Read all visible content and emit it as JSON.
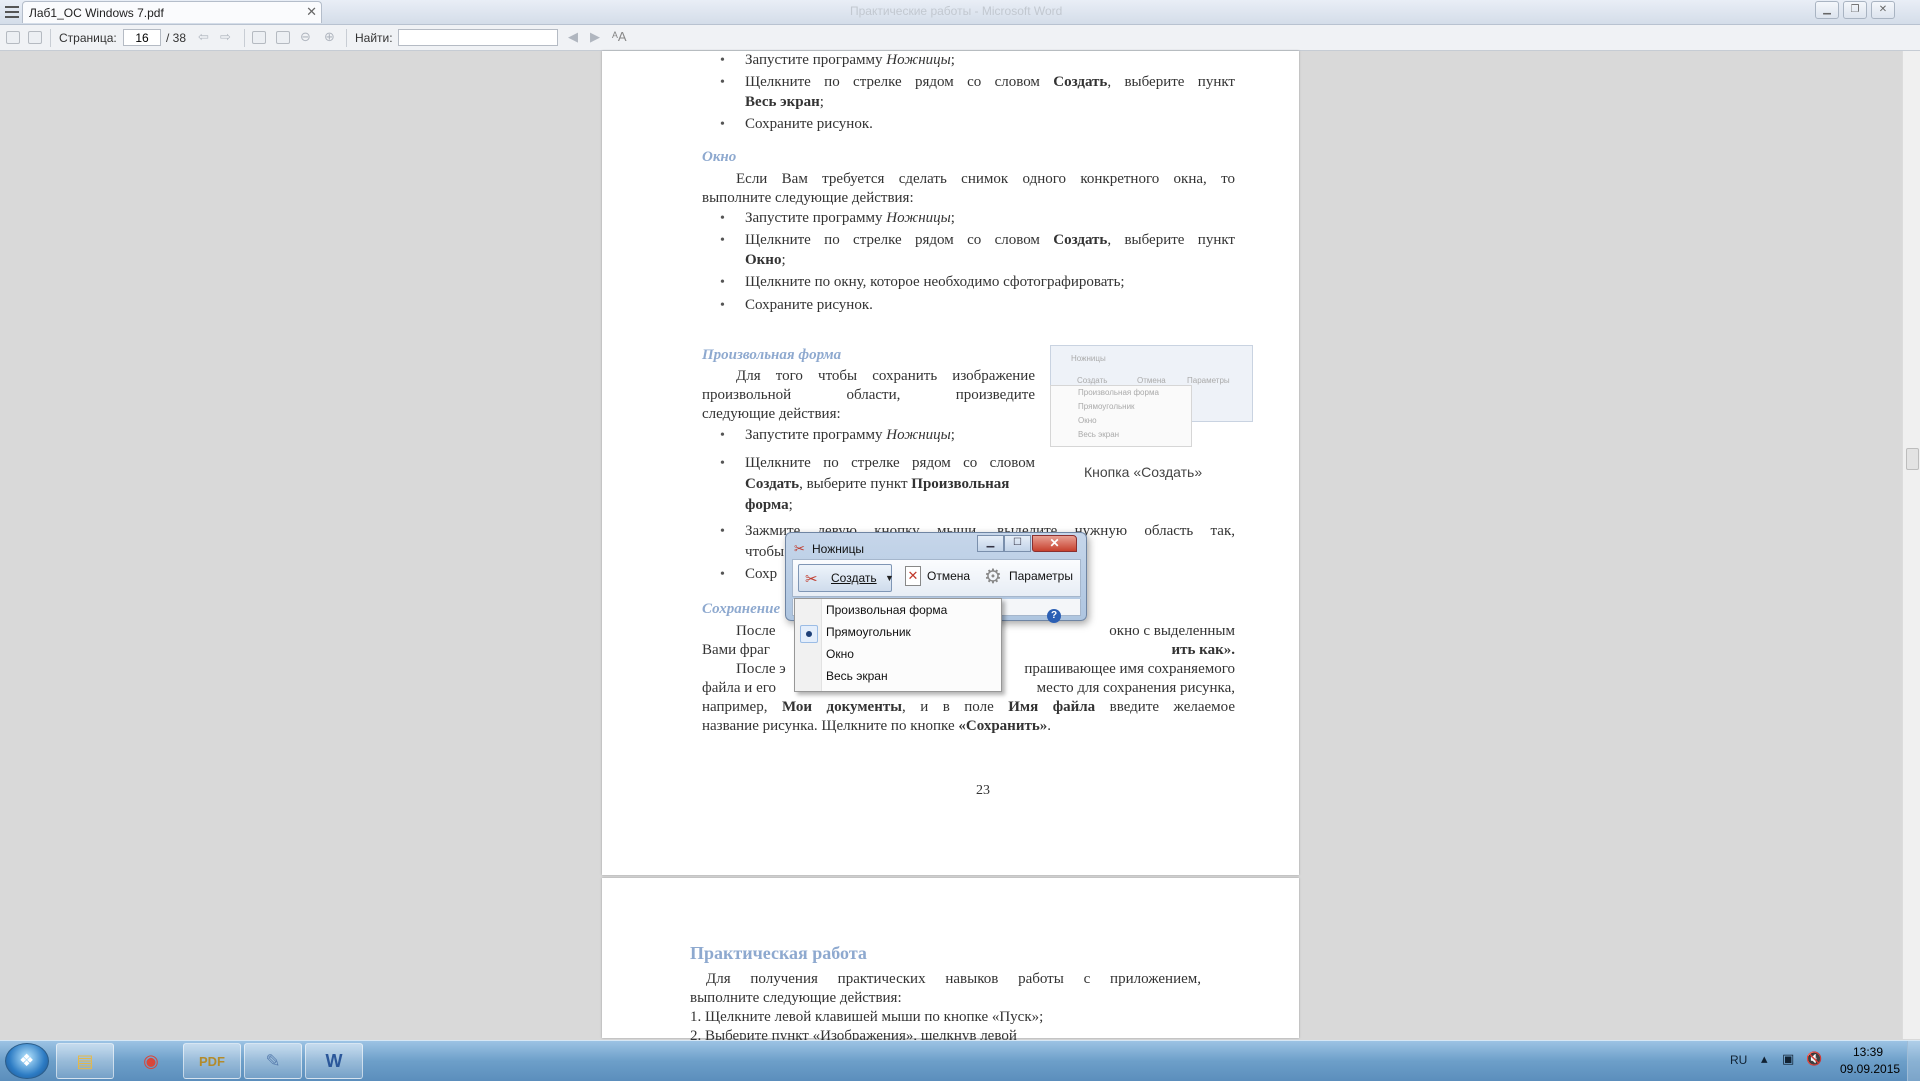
{
  "window": {
    "tab_title": "Лаб1_ОС Windows 7.pdf",
    "title": "Практические работы - Microsoft Word",
    "tab_close_icon": "close-icon"
  },
  "toolbar": {
    "page_label": "Страница:",
    "page_value": "16",
    "page_total": "/ 38",
    "find_label": "Найти:",
    "find_value": ""
  },
  "page1": {
    "bullets_top": [
      {
        "pre": "Запустите программу ",
        "it": "Ножницы",
        "post": ";"
      },
      {
        "line1": "Щелкните по стрелке рядом со словом ",
        "bold1": "Создать",
        "line1b": ", выберите пункт",
        "bold2": "Весь экран",
        "end": ";"
      },
      {
        "text": "Сохраните рисунок."
      }
    ],
    "okno_heading": "Окно",
    "okno_para_1": "Если Вам требуется сделать снимок одного конкретного окна, то",
    "okno_para_2": "выполните следующие действия:",
    "okno_b1_pre": "Запустите программу ",
    "okno_b1_it": "Ножницы",
    "okno_b1_post": ";",
    "okno_b2_pre": "Щелкните по стрелке рядом со словом ",
    "okno_b2_bold": "Создать",
    "okno_b2_post": ", выберите пункт",
    "okno_b2_bold2": "Окно",
    "okno_b2_end": ";",
    "okno_b3": "Щелкните по окну, которое необходимо сфотографировать;",
    "okno_b4": "Сохраните рисунок.",
    "free_heading": "Произвольная форма",
    "free_para_1": "Для того чтобы сохранить изображение",
    "free_para_2": "произвольной области, произведите",
    "free_para_3": "следующие действия:",
    "free_b1_pre": "Запустите программу ",
    "free_b1_it": "Ножницы",
    "free_b1_post": ";",
    "free_b2_line1": "Щелкните по стрелке рядом со словом",
    "free_b2_bold": "Создать",
    "free_b2_mid": ", выберите пункт ",
    "free_b2_bold2": "Произвольная",
    "free_b2_bold3": "форма",
    "free_b2_end": ";",
    "free_b3_visible": "Зажмите левую кнопку мыши, выделите нужную область так,",
    "free_b3_visible_2": "чтобы",
    "free_b4_visible": "Сохр",
    "save_heading": "Сохранение",
    "save_para_1a": "После",
    "save_para_1b": "окно с выделенным",
    "save_para_2a": "Вами фраг",
    "save_para_2b": "ить как».",
    "save_para_3a": "После э",
    "save_para_3b": "прашивающее имя сохраняемого",
    "save_para_4a": "файла и его",
    "save_para_4b": "место для сохранения рисунка,",
    "save_para_5_pre": "например, ",
    "save_para_5_b1": "Мои документы",
    "save_para_5_mid": ", и в поле ",
    "save_para_5_b2": "Имя файла",
    "save_para_5_post": " введите желаемое",
    "save_para_6_pre": "название рисунка. Щелкните по кнопке ",
    "save_para_6_b": "«Сохранить»",
    "save_para_6_post": ".",
    "page_number": "23",
    "figure": {
      "title": "Ножницы",
      "new": "Создать",
      "cancel": "Отмена",
      "options": "Параметры",
      "menu": [
        "Произвольная форма",
        "Прямоугольник",
        "Окно",
        "Весь экран"
      ],
      "caption": "Кнопка «Создать»"
    }
  },
  "page2": {
    "heading": "Практическая работа",
    "para_1": "Для получения практических навыков работы с приложением,",
    "para_2": "выполните следующие действия:",
    "item_1": "1.  Щелкните левой клавишей мыши по кнопке «Пуск»;",
    "item_2": "2.  Выберите пункт «Изображения», щелкнув левой"
  },
  "snipping_tool": {
    "title": "Ножницы",
    "new_label": "Создать",
    "cancel_label": "Отмена",
    "options_label": "Параметры",
    "help": "?",
    "menu": [
      {
        "label": "Произвольная форма",
        "selected": false
      },
      {
        "label": "Прямоугольник",
        "selected": true
      },
      {
        "label": "Окно",
        "selected": false
      },
      {
        "label": "Весь экран",
        "selected": false
      }
    ]
  },
  "taskbar": {
    "apps": [
      "explorer-icon",
      "chrome-icon",
      "pdf-reader-icon",
      "paint-icon",
      "word-icon"
    ],
    "lang": "RU",
    "time": "13:39",
    "date": "09.09.2015"
  }
}
